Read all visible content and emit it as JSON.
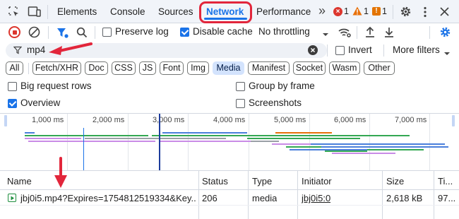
{
  "tabs": {
    "elements": "Elements",
    "console": "Console",
    "sources": "Sources",
    "network": "Network",
    "performance": "Performance",
    "more": "»",
    "errors_count": "1",
    "warnings_count": "1",
    "issues_count": "1"
  },
  "toolbar": {
    "preserve_log": "Preserve log",
    "disable_cache": "Disable cache",
    "throttling": "No throttling"
  },
  "filter": {
    "value": "mp4",
    "invert": "Invert",
    "more_filters": "More filters"
  },
  "chips": [
    "All",
    "Fetch/XHR",
    "Doc",
    "CSS",
    "JS",
    "Font",
    "Img",
    "Media",
    "Manifest",
    "Socket",
    "Wasm",
    "Other"
  ],
  "active_chip": "Media",
  "options": {
    "big_request_rows": "Big request rows",
    "group_by_frame": "Group by frame",
    "overview": "Overview",
    "screenshots": "Screenshots"
  },
  "overview": {
    "ticks": [
      "1,000 ms",
      "2,000 ms",
      "3,000 ms",
      "4,000 ms",
      "5,000 ms",
      "6,000 ms",
      "7,000 ms"
    ]
  },
  "table": {
    "headers": {
      "name": "Name",
      "status": "Status",
      "type": "Type",
      "initiator": "Initiator",
      "size": "Size",
      "time": "Ti..."
    },
    "rows": [
      {
        "name": "jbj0i5.mp4?Expires=1754812519334&Key...",
        "status": "206",
        "type": "media",
        "initiator": "jbj0i5:0",
        "size": "2,618 kB",
        "time": "97..."
      }
    ]
  },
  "colors": {
    "accent": "#1a73e8",
    "annotation_red": "#e2263b",
    "error_red": "#dc362e",
    "warning_orange": "#e8710a",
    "issue_orange": "#e37400"
  }
}
